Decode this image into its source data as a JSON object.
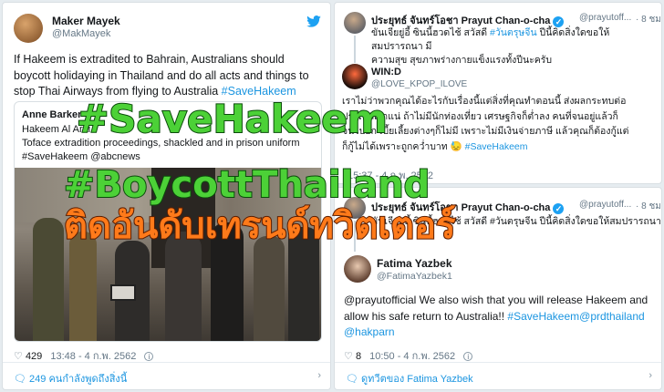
{
  "left_tweet": {
    "name": "Maker Mayek",
    "handle": "@MakMayek",
    "text_before_tag": "If Hakeem is extradited to Bahrain, Australians should boycott holidaying in Thailand and do all acts and things to stop Thai Airways from flying to Australia ",
    "tag": "#SaveHakeem",
    "quote": {
      "name": "Anne Barker",
      "line1": "Hakeem Al Arai",
      "line2": "Toface extradition proceedings, shackled and in prison uniform",
      "line3": "#SaveHakeem @abcnews"
    },
    "likes": "429",
    "time": "13:48 - 4 ก.พ. 2562",
    "link": "249 คนกำลังพูดถึงสิ่งนี้"
  },
  "top_right": {
    "name": "ประยุทธ์ จันทร์โอชา Prayut Chan-o-cha",
    "handle": "@prayutoff...",
    "ago": "· 8 ชม.",
    "line1_text": "ขันเจียยู่อี้ ซินนี้ฮวดไช้ สวัสดี ",
    "line1_tag": "#วันตรุษจีน",
    "line1_rest": " ปีนี้คิดสิ่งใดขอให้สมปรารถนา มี",
    "line2": "ความสุข สุขภาพร่างกายแข็งแรงทั้งปีนะครับ",
    "reply_name": "WIN:D",
    "reply_handle": "@LOVE_KPOP_ILOVE",
    "reply_line1": "เราไม่ว่าพวกคุณได้อะไรกับเรื่องนี้แต่สิ่งที่คุณทำตอนนี้ ส่งผลกระทบต่อ",
    "reply_line2": "ประเทศเราแน่ ถ้าไม่มีนักท่องเที่ยว เศรษฐกิจก็ต่ำลง คนที่จนอยู่แล้วก็",
    "reply_line3": "จนไปอีก เบี้ยเลี้ยงต่างๆก็ไม่มี เพราะไม่มีเงินจ่ายภาษี แล้วคุณก็ต้องกู้แต่",
    "reply_line4": "ก็กู้ไม่ได้เพราะถูกคว่ำบาท 😓 ",
    "reply_tag": "#SaveHakeem",
    "time": "15:37 - 4 ก.พ. 2562"
  },
  "bottom_right": {
    "name": "ประยุทธ์ จันทร์โอชา Prayut Chan-o-cha",
    "handle": "@prayutoff...",
    "ago": "· 8 ชม.",
    "line1": "ขันเจียยู่อี้ ซินนี้ฮวดไช้ สวัสดี #วันตรุษจีน ปีนี้คิดสิ่งใดขอให้สมปรารถนา มี",
    "reply_name": "Fatima Yazbek",
    "reply_handle": "@FatimaYazbek1",
    "reply_text": "@prayutofficial We also wish that you will release Hakeem and allow his safe return to Australia!! ",
    "reply_tags": "#SaveHakeem@prdthailand @hakparn",
    "likes": "8",
    "time": "10:50 - 4 ก.พ. 2562",
    "link": "ดูทวีตของ Fatima Yazbek"
  },
  "overlay": {
    "tag1": "#SaveHakeem",
    "tag2": "#BoycottThailand",
    "caption": "ติดอันดับเทรนด์ทวิตเตอร์"
  },
  "colors": {
    "link": "#1b95e0",
    "green": "#4cd137",
    "orange": "#ff7a1a"
  }
}
